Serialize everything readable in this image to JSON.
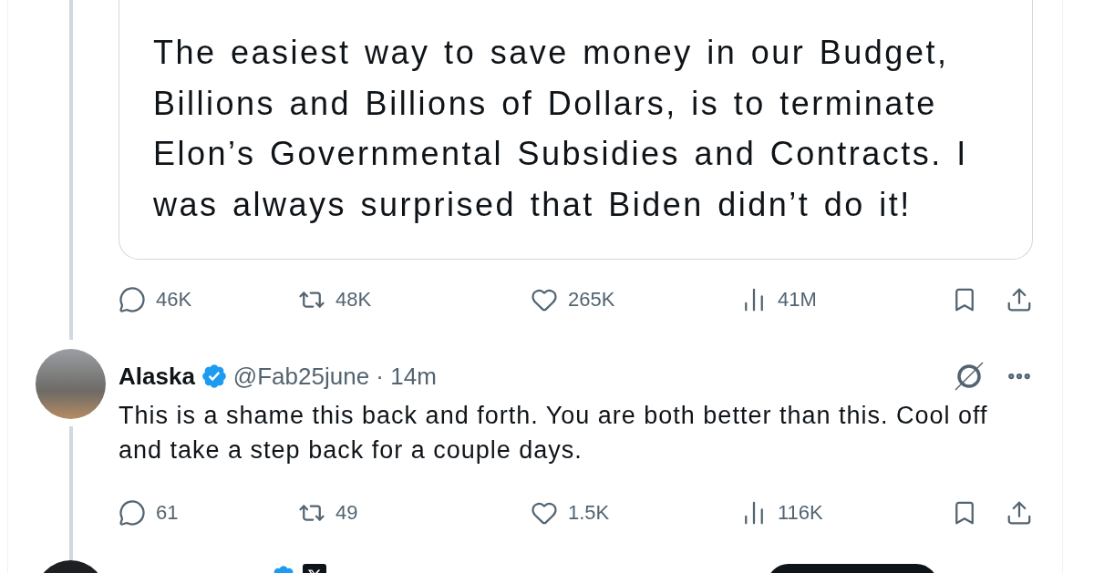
{
  "quoted_post": {
    "text": "The easiest way to save money in our Budget, Billions and Billions of Dollars, is to terminate Elon’s Governmental Subsidies and Contracts. I was always surprised that Biden didn’t do it!"
  },
  "quoted_actions": [
    {
      "kind": "reply",
      "count": "46K"
    },
    {
      "kind": "repost",
      "count": "48K"
    },
    {
      "kind": "like",
      "count": "265K"
    },
    {
      "kind": "views",
      "count": "41M"
    },
    {
      "kind": "bookmark"
    },
    {
      "kind": "share"
    }
  ],
  "reply": {
    "name": "Alaska",
    "verified": true,
    "meta": "@Fab25june · 14m",
    "text": "This is a shame this back and forth. You are both better than this. Cool off and take a step back for a couple days.",
    "actions": [
      {
        "kind": "reply",
        "count": "61"
      },
      {
        "kind": "repost",
        "count": "49"
      },
      {
        "kind": "like",
        "count": "1.5K"
      },
      {
        "kind": "views",
        "count": "116K"
      },
      {
        "kind": "bookmark"
      },
      {
        "kind": "share"
      }
    ]
  },
  "next_post": {
    "verified": true,
    "affiliate": true
  }
}
